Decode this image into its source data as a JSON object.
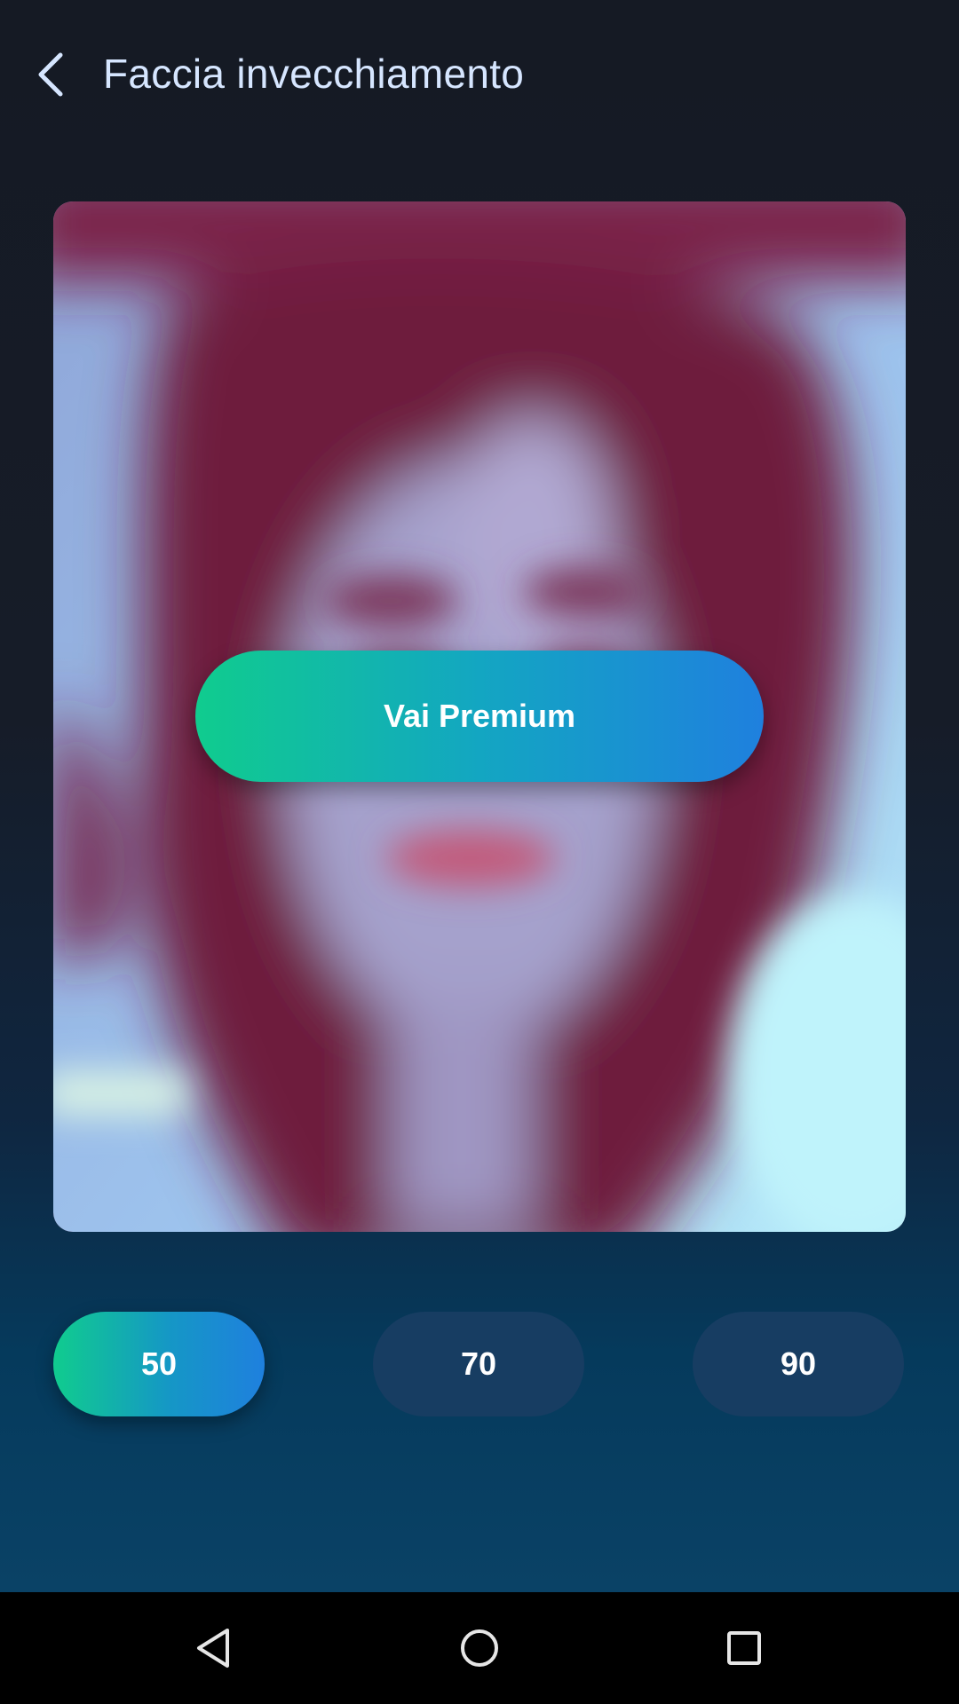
{
  "header": {
    "title": "Faccia invecchiamento",
    "back_icon": "chevron-left-icon"
  },
  "photo": {
    "description_icon": "blurred-portrait-image"
  },
  "premium": {
    "label": "Vai Premium"
  },
  "age_options": {
    "items": [
      {
        "label": "50",
        "selected": true
      },
      {
        "label": "70",
        "selected": false
      },
      {
        "label": "90",
        "selected": false
      }
    ]
  },
  "nav": {
    "back_icon": "triangle-back-icon",
    "home_icon": "circle-home-icon",
    "recents_icon": "square-recents-icon"
  },
  "colors": {
    "accent_start": "#10cc8e",
    "accent_end": "#1f80de",
    "title": "#d6e6ff",
    "unselected_pill": "#173d62"
  }
}
